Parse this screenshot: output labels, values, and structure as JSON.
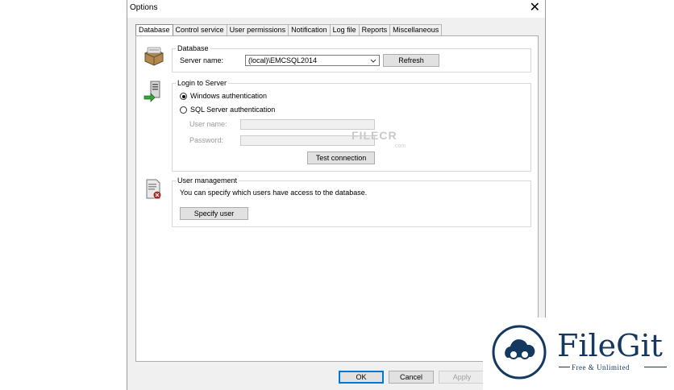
{
  "window": {
    "title": "Options",
    "close": "✕"
  },
  "tabs": [
    "Database",
    "Control service",
    "User permissions",
    "Notification",
    "Log file",
    "Reports",
    "Miscellaneous"
  ],
  "database_group": {
    "label": "Database",
    "server_name_label": "Server name:",
    "server_name_value": "(local)\\EMCSQL2014",
    "refresh_label": "Refresh"
  },
  "login_group": {
    "label": "Login to Server",
    "windows_auth_label": "Windows authentication",
    "windows_auth_checked": true,
    "sql_auth_label": "SQL Server authentication",
    "sql_auth_checked": false,
    "user_name_label": "User name:",
    "user_name_value": "",
    "password_label": "Password:",
    "password_value": "",
    "test_connection_label": "Test connection"
  },
  "user_mgmt_group": {
    "label": "User management",
    "description": "You can specify which users have access to the database.",
    "specify_user_label": "Specify user"
  },
  "footer": {
    "ok": "OK",
    "cancel": "Cancel",
    "apply": "Apply"
  },
  "watermark": {
    "filecr": "FILECR",
    "filecr_sub": ".com"
  },
  "badge": {
    "name": "FileGit",
    "tagline": "Free & Unlimited"
  },
  "colors": {
    "accent": "#0078d7",
    "brand": "#14385f"
  }
}
